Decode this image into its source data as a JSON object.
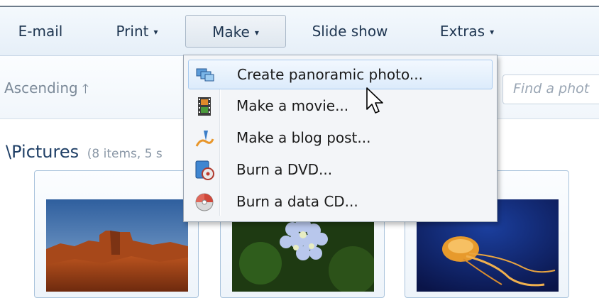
{
  "toolbar": {
    "email": "E-mail",
    "print": "Print",
    "make": "Make",
    "slideshow": "Slide show",
    "extras": "Extras",
    "caret": "▾"
  },
  "subbar": {
    "sort_label": "Ascending",
    "sort_arrow": "🡑",
    "search_placeholder": "Find a phot"
  },
  "content": {
    "path_title": "\\Pictures",
    "path_meta": "(8 items, 5 s"
  },
  "menu": {
    "items": [
      {
        "label": "Create panoramic photo...",
        "icon": "panorama-icon"
      },
      {
        "label": "Make a movie...",
        "icon": "film-icon"
      },
      {
        "label": "Make a blog post...",
        "icon": "blog-pen-icon"
      },
      {
        "label": "Burn a DVD...",
        "icon": "dvd-burn-icon"
      },
      {
        "label": "Burn a data CD...",
        "icon": "cd-burn-icon"
      }
    ],
    "highlighted_index": 0
  },
  "colors": {
    "accent": "#1f3f66",
    "menu_hover": "#dcebfb",
    "toolbar_bg": "#e6eff8"
  }
}
